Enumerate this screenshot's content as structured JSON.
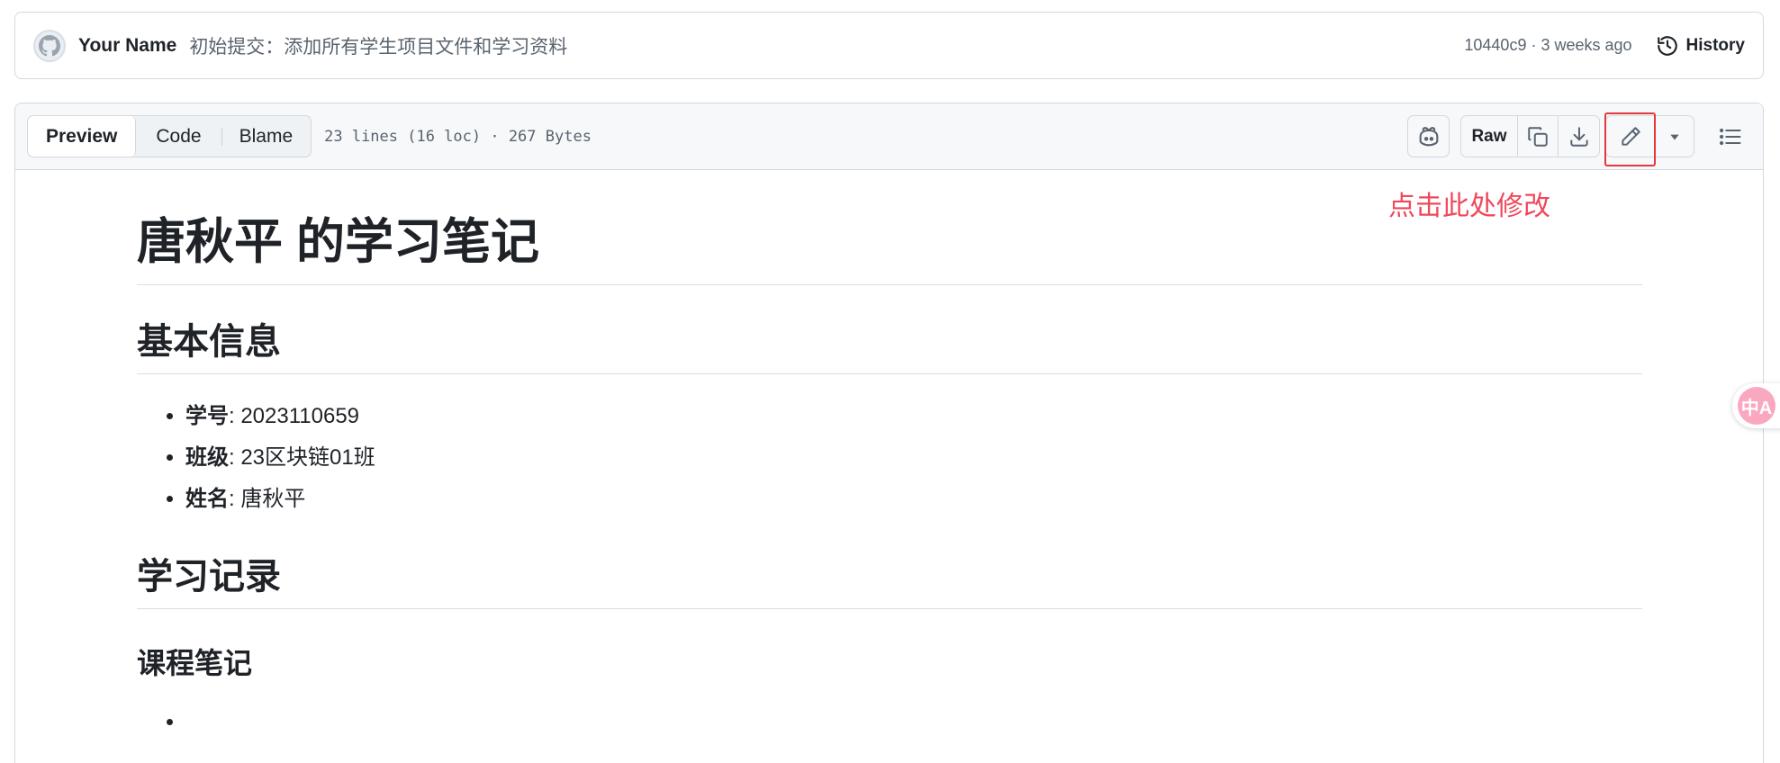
{
  "commit": {
    "author": "Your Name",
    "message": "初始提交：添加所有学生项目文件和学习资料",
    "meta": "10440c9 · 3 weeks ago",
    "history_label": "History"
  },
  "file_header": {
    "tabs": [
      {
        "label": "Preview",
        "active": true
      },
      {
        "label": "Code",
        "active": false
      },
      {
        "label": "Blame",
        "active": false
      }
    ],
    "info": "23 lines (16 loc) · 267 Bytes",
    "raw_label": "Raw"
  },
  "annotation": {
    "text": "点击此处修改",
    "color": "#f0475a"
  },
  "document": {
    "title": "唐秋平 的学习笔记",
    "section1": {
      "heading": "基本信息",
      "items": [
        {
          "label": "学号",
          "value": ": 2023110659"
        },
        {
          "label": "班级",
          "value": ": 23区块链01班"
        },
        {
          "label": "姓名",
          "value": ": 唐秋平"
        }
      ]
    },
    "section2": {
      "heading": "学习记录",
      "sub_heading": "课程笔记"
    }
  },
  "floating": {
    "translate_glyph": "中A"
  },
  "colors": {
    "border": "#d1d9e0",
    "header_bg": "#f6f8fa",
    "text": "#1f2328",
    "muted": "#59636e",
    "highlight_red": "#e5383b"
  }
}
